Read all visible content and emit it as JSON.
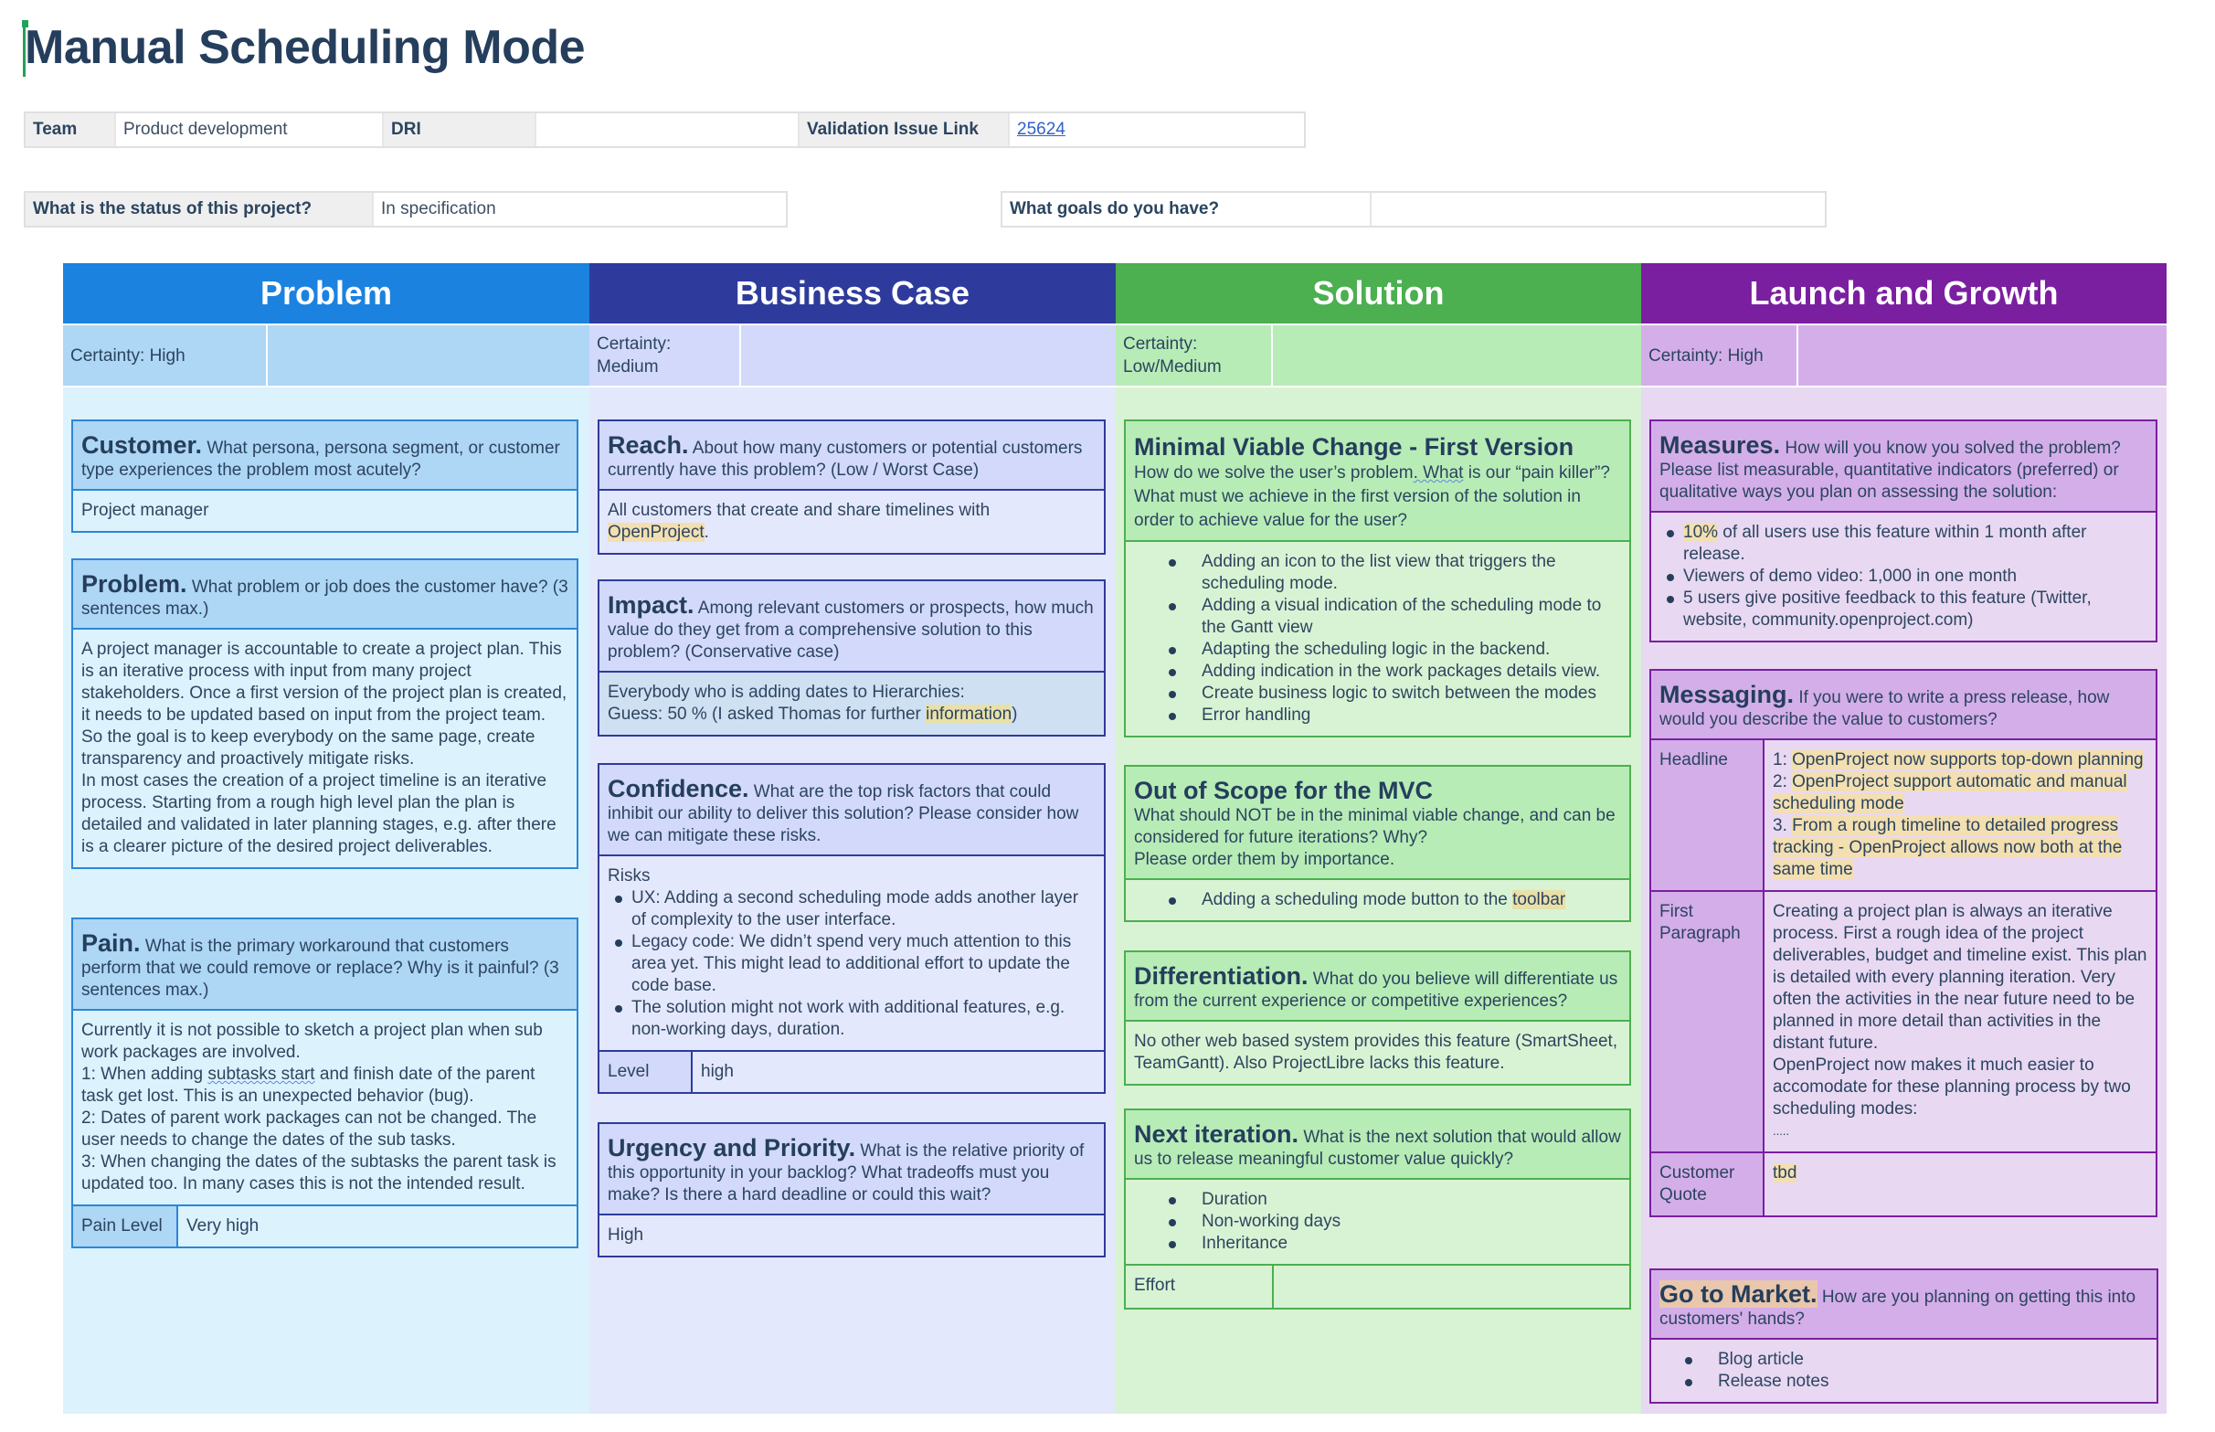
{
  "page": {
    "title": "Manual Scheduling Mode"
  },
  "meta": {
    "team_label": "Team",
    "team_value": "Product development",
    "dri_label": "DRI",
    "dri_value": "",
    "validation_label": "Validation Issue Link",
    "validation_value": "25624",
    "status_label": "What is the status of this project?",
    "status_value": "In specification",
    "goals_label": "What goals do you have?",
    "goals_value": ""
  },
  "colors": {
    "problem": "#1b82e0",
    "business_case": "#2e3b9c",
    "solution": "#4caf50",
    "launch_growth": "#7a1fa0",
    "highlight": "#f3dfb0",
    "link": "#2f62c8"
  },
  "columns": {
    "problem": {
      "title": "Problem",
      "certainty": "Certainty: High",
      "customer": {
        "title": "Customer.",
        "question": "What persona, persona segment, or customer type experiences the problem most acutely?",
        "answer": "Project manager"
      },
      "problem": {
        "title": "Problem.",
        "question": "What problem or job does the customer have? (3 sentences max.)",
        "answer_lines": [
          "A project manager is accountable to create a project plan. This is an iterative process with input from many project stakeholders. Once a first version of the project plan is created, it needs to be updated based on input from the project team.",
          "So the goal is to keep everybody on the same page, create transparency and proactively mitigate risks.",
          "In most cases the creation of a project timeline is an iterative process. Starting from a rough high level plan the plan is detailed and validated in later planning stages, e.g. after there is a clearer picture of the desired project deliverables."
        ]
      },
      "pain": {
        "title": "Pain.",
        "question": "What is the primary workaround that customers perform that we could remove or replace? Why is it painful? (3 sentences max.)",
        "answer_lines": [
          "Currently it is not possible to sketch a project plan when sub work packages are involved.",
          "1: When adding ",
          "subtasks start",
          " and finish date of the parent task get lost. This is an unexpected behavior (bug).",
          "2: Dates of parent work packages can not be changed. The user needs to change the dates of the sub tasks.",
          "3: When changing the dates of the subtasks the parent task is updated too. In many cases this is not the intended result."
        ],
        "level_label": "Pain Level",
        "level_value": "Very high"
      }
    },
    "business_case": {
      "title": "Business Case",
      "certainty": "Certainty: Medium",
      "reach": {
        "title": "Reach.",
        "question": "About how many customers or potential customers currently have this problem? (Low / Worst Case)",
        "answer_prefix": "All customers that create and share timelines with ",
        "answer_highlight": "OpenProject",
        "answer_suffix": "."
      },
      "impact": {
        "title": "Impact.",
        "question": "Among relevant customers or prospects, how much value do they get from a comprehensive solution to this problem? (Conservative case)",
        "answer_line1": "Everybody who is adding dates to Hierarchies:",
        "answer_line2_prefix": "Guess: 50 % (I asked Thomas for further ",
        "answer_line2_highlight": "information",
        "answer_line2_suffix": ")"
      },
      "confidence": {
        "title": "Confidence.",
        "question": "What are the top risk factors that could inhibit our ability to deliver this solution? Please consider how we can mitigate these risks.",
        "risks_label": "Risks",
        "risks": [
          "UX: Adding a second scheduling mode adds another layer of complexity to the user interface.",
          "Legacy code: We didn’t spend very much attention to this area yet. This might lead to additional effort to update the code base.",
          "The solution might not work with additional features, e.g. non-working days, duration."
        ],
        "level_label": "Level",
        "level_value": "high"
      },
      "urgency": {
        "title": "Urgency and Priority.",
        "question": "What is the relative priority of this opportunity in your backlog? What tradeoffs must you make? Is there a hard deadline or could this wait?",
        "answer": "High"
      }
    },
    "solution": {
      "title": "Solution",
      "certainty": "Certainty: Low/Medium",
      "mvc": {
        "title": "Minimal Viable Change - First Version",
        "question_part1": "How do we solve the user’s problem",
        "question_squig": ". What",
        "question_part2": " is our “pain killer”? What must we achieve in the first version of the solution in order to achieve value for the user?",
        "items": [
          "Adding an icon to the list view that triggers the scheduling mode.",
          "Adding a visual indication of the scheduling mode to the Gantt view",
          "Adapting the scheduling logic in the backend.",
          "Adding indication in the work packages details view.",
          "Create business logic to switch between the modes",
          "Error handling"
        ]
      },
      "out_of_scope": {
        "title": "Out of Scope for the MVC",
        "question": "What should NOT be in the minimal viable change, and can be considered for future iterations? Why?",
        "question2": "Please order them by importance.",
        "item_prefix": "Adding a scheduling mode button to the ",
        "item_highlight": "toolbar"
      },
      "differentiation": {
        "title": "Differentiation.",
        "question": "What do you believe will differentiate us from the current experience or competitive experiences?",
        "answer": "No other web based system provides this feature (SmartSheet, TeamGantt). Also ProjectLibre lacks this feature."
      },
      "next_iteration": {
        "title": "Next iteration.",
        "question": "What is the next solution that would allow us to release meaningful customer value quickly?",
        "items": [
          "Duration",
          "Non-working days",
          "Inheritance"
        ],
        "effort_label": "Effort",
        "effort_value": ""
      }
    },
    "launch_growth": {
      "title": "Launch and Growth",
      "certainty": "Certainty: High",
      "measures": {
        "title": "Measures.",
        "question": "How will you know you solved the problem? Please list measurable, quantitative indicators (preferred) or qualitative ways you plan on assessing the solution:",
        "item1_highlight": "10%",
        "item1_rest": " of all users use this feature within 1 month after release.",
        "item2": "Viewers of demo video: 1,000 in one month",
        "item3": "5 users give positive feedback to this feature (Twitter, website, community.openproject.com)"
      },
      "messaging": {
        "title": "Messaging.",
        "question": "If you were to write a press release, how would you describe the value to customers?",
        "headline_label": "Headline",
        "headlines": [
          {
            "num": "1: ",
            "text": "OpenProject now supports top-down planning"
          },
          {
            "num": "2: ",
            "text": "OpenProject support automatic and manual scheduling mode"
          },
          {
            "num": "3. ",
            "text": "From a rough timeline to detailed progress tracking - OpenProject allows now both at the same time"
          }
        ],
        "first_paragraph_label": "First Paragraph",
        "first_paragraph_lines": [
          "Creating a project plan is always an iterative process. First a rough idea of the project deliverables, budget and timeline exist. This plan is detailed with every planning iteration. Very often the activities in the near future need to be planned in more detail than activities in the distant future.",
          "OpenProject now makes it much easier to accomodate for these planning process by two scheduling modes:",
          "....."
        ],
        "quote_label": "Customer Quote",
        "quote_value": "tbd"
      },
      "go_to_market": {
        "title": "Go to Market.",
        "question": "How are you planning on getting this into customers' hands?",
        "items": [
          "Blog article",
          "Release notes"
        ]
      }
    }
  }
}
